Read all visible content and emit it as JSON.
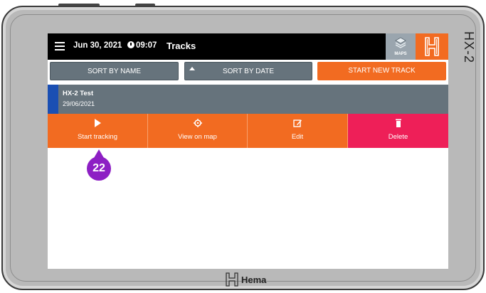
{
  "device": {
    "model": "HX-2",
    "brand": "Hema"
  },
  "topbar": {
    "date": "Jun 30, 2021",
    "time": "09:07",
    "title": "Tracks",
    "maps_label": "MAPS"
  },
  "sort": {
    "by_name": "SORT BY NAME",
    "by_date": "SORT BY DATE",
    "start_new": "START NEW TRACK"
  },
  "track": {
    "name": "HX-2 Test",
    "date": "29/06/2021"
  },
  "actions": {
    "start": "Start tracking",
    "view": "View on map",
    "edit": "Edit",
    "delete": "Delete"
  },
  "callout": {
    "number": "22"
  },
  "colors": {
    "accent": "#f26b21",
    "grey": "#66737c",
    "delete": "#ee1f58",
    "selected_bar": "#1a4fb3",
    "callout": "#8d1fc4"
  },
  "icons": [
    "menu-icon",
    "clock-icon",
    "layers-icon",
    "hema-logo-icon",
    "sort-asc-icon",
    "play-icon",
    "target-icon",
    "edit-icon",
    "trash-icon"
  ]
}
